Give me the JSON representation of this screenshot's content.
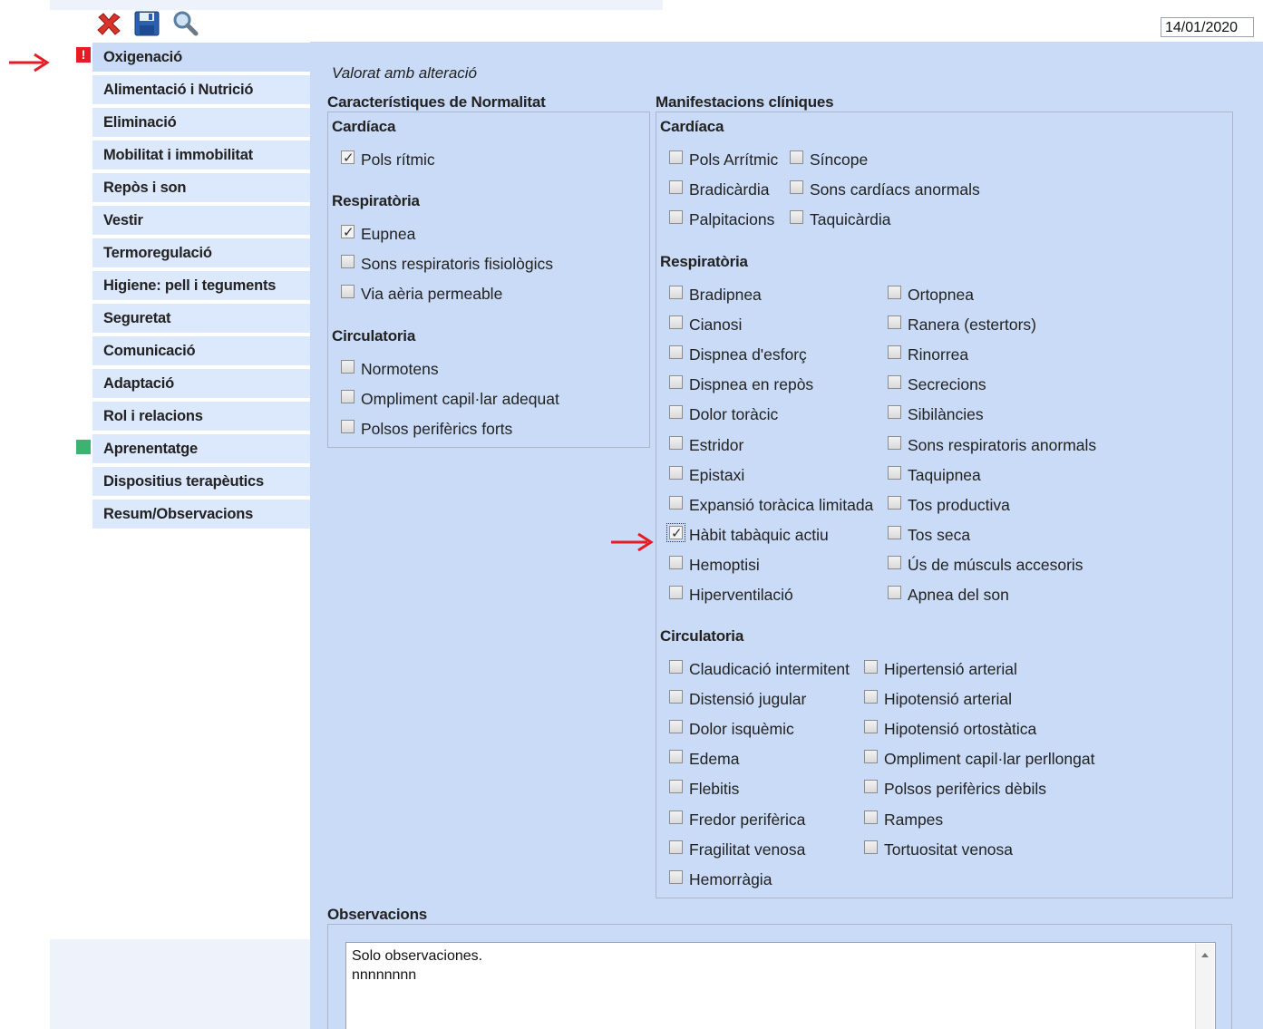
{
  "toolbar": {
    "delete_icon": "red-x-icon",
    "save_icon": "floppy-disk-icon",
    "search_icon": "magnifier-icon"
  },
  "date": "14/01/2020",
  "colors": {
    "panel": "#c9dbf6",
    "nav": "#dce8fb",
    "alert": "#e51c23",
    "ok": "#3cb371",
    "arrow": "#e51c23"
  },
  "sidebar": {
    "items": [
      {
        "label": "Oxigenació",
        "badge": "alert"
      },
      {
        "label": "Alimentació i Nutrició"
      },
      {
        "label": "Eliminació"
      },
      {
        "label": "Mobilitat i immobilitat"
      },
      {
        "label": "Repòs i son"
      },
      {
        "label": "Vestir"
      },
      {
        "label": "Termoregulació"
      },
      {
        "label": "Higiene: pell i teguments"
      },
      {
        "label": "Seguretat"
      },
      {
        "label": "Comunicació"
      },
      {
        "label": "Adaptació"
      },
      {
        "label": "Rol i relacions"
      },
      {
        "label": "Aprenentatge",
        "badge": "ok"
      },
      {
        "label": "Dispositius terapèutics"
      },
      {
        "label": "Resum/Observacions"
      }
    ]
  },
  "main": {
    "status": "Valorat amb alteració",
    "normal": {
      "title": "Característiques de Normalitat",
      "cardiaca": {
        "title": "Cardíaca",
        "items": [
          {
            "label": "Pols rítmic",
            "checked": true
          }
        ]
      },
      "respiratoria": {
        "title": "Respiratòria",
        "items": [
          {
            "label": "Eupnea",
            "checked": true
          },
          {
            "label": "Sons respiratoris fisiològics",
            "checked": false
          },
          {
            "label": "Via aèria permeable",
            "checked": false
          }
        ]
      },
      "circulatoria": {
        "title": "Circulatoria",
        "items": [
          {
            "label": "Normotens",
            "checked": false
          },
          {
            "label": "Ompliment capil·lar adequat",
            "checked": false
          },
          {
            "label": "Polsos perifèrics forts",
            "checked": false
          }
        ]
      }
    },
    "clinical": {
      "title": "Manifestacions clíniques",
      "cardiaca": {
        "title": "Cardíaca",
        "col1": [
          "Pols Arrítmic",
          "Bradicàrdia",
          "Palpitacions"
        ],
        "col2": [
          "Síncope",
          "Sons cardíacs anormals",
          "Taquicàrdia"
        ]
      },
      "respiratoria": {
        "title": "Respiratòria",
        "col1": [
          "Bradipnea",
          "Cianosi",
          "Dispnea d'esforç",
          "Dispnea en repòs",
          "Dolor toràcic",
          "Estridor",
          "Epistaxi",
          "Expansió toràcica limitada",
          "Hàbit tabàquic actiu",
          "Hemoptisi",
          "Hiperventilació"
        ],
        "col2": [
          "Ortopnea",
          "Ranera (estertors)",
          "Rinorrea",
          "Secrecions",
          "Sibilàncies",
          "Sons respiratoris anormals",
          "Taquipnea",
          "Tos productiva",
          "Tos seca",
          "Ús de músculs accesoris",
          "Apnea del son"
        ],
        "checked": "Hàbit tabàquic actiu"
      },
      "circulatoria": {
        "title": "Circulatoria",
        "col1": [
          "Claudicació intermitent",
          "Distensió jugular",
          "Dolor isquèmic",
          "Edema",
          "Flebitis",
          "Fredor perifèrica",
          "Fragilitat venosa",
          "Hemorràgia"
        ],
        "col2": [
          "Hipertensió arterial",
          "Hipotensió arterial",
          "Hipotensió ortostàtica",
          "Ompliment capil·lar perllongat",
          "Polsos perifèrics dèbils",
          "Rampes",
          "Tortuositat venosa"
        ]
      }
    },
    "observations": {
      "title": "Observacions",
      "text": "Solo observaciones.\nnnnnnnnn"
    }
  }
}
